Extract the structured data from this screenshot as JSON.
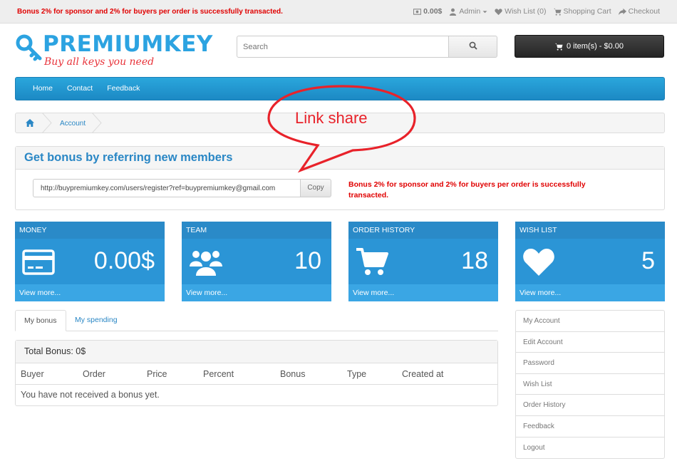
{
  "topbar": {
    "notice": "Bonus 2% for sponsor and 2% for buyers per order is successfully transacted.",
    "money": "0.00$",
    "admin": "Admin",
    "wishlist": "Wish List (0)",
    "cart": "Shopping Cart",
    "checkout": "Checkout"
  },
  "logo": {
    "main": "PREMIUMKEY",
    "tagline": "Buy all keys you need"
  },
  "search": {
    "placeholder": "Search"
  },
  "cart_button": {
    "label": "0 item(s) - $0.00"
  },
  "nav": {
    "items": [
      "Home",
      "Contact",
      "Feedback"
    ]
  },
  "breadcrumb": {
    "current": "Account"
  },
  "callout": {
    "text": "Link share"
  },
  "bonus": {
    "title": "Get bonus by referring new members",
    "ref_link": "http://buypremiumkey.com/users/register?ref=buypremiumkey@gmail.com",
    "copy_label": "Copy",
    "note": "Bonus 2% for sponsor and 2% for buyers per order is successfully transacted."
  },
  "stats": [
    {
      "title": "MONEY",
      "value": "0.00$",
      "footer": "View more...",
      "icon": "credit-card-icon"
    },
    {
      "title": "TEAM",
      "value": "10",
      "footer": "View more...",
      "icon": "users-icon"
    },
    {
      "title": "ORDER HISTORY",
      "value": "18",
      "footer": "View more...",
      "icon": "shopping-cart-icon"
    },
    {
      "title": "WISH LIST",
      "value": "5",
      "footer": "View more...",
      "icon": "heart-icon"
    }
  ],
  "tabs": [
    {
      "label": "My bonus",
      "active": true
    },
    {
      "label": "My spending",
      "active": false
    }
  ],
  "bonus_table": {
    "title": "Total Bonus: 0$",
    "columns": [
      "Buyer",
      "Order",
      "Price",
      "Percent",
      "Bonus",
      "Type",
      "Created at"
    ],
    "empty_text": "You have not received a bonus yet."
  },
  "side_menu": [
    "My Account",
    "Edit Account",
    "Password",
    "Wish List",
    "Order History",
    "Feedback",
    "Logout"
  ],
  "colors": {
    "accent": "#2b95d6",
    "alert": "#e00000",
    "callout": "#e8222a"
  }
}
